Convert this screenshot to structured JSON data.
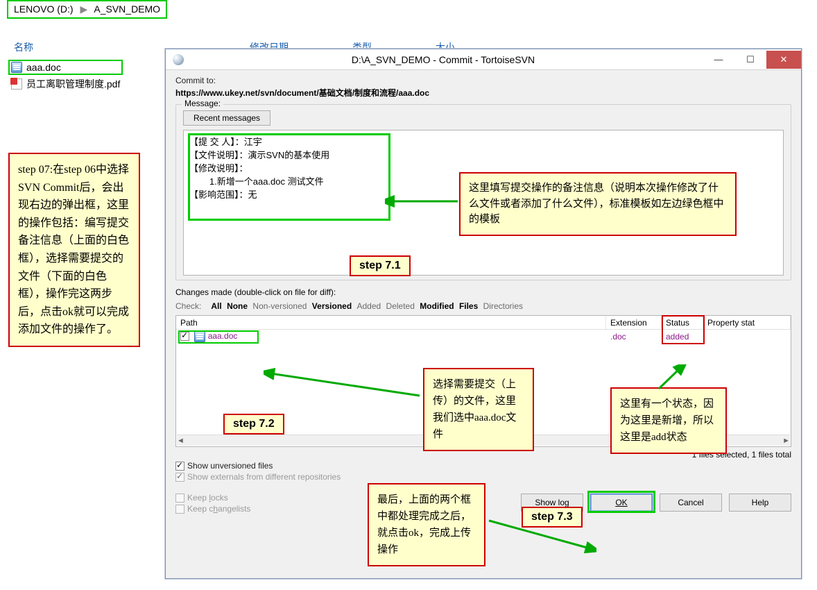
{
  "breadcrumb": {
    "drive": "LENOVO (D:)",
    "folder": "A_SVN_DEMO"
  },
  "columns": {
    "name": "名称",
    "date": "修改日期",
    "type": "类型",
    "size": "大小"
  },
  "files": {
    "f1": "aaa.doc",
    "f2": "员工离职管理制度.pdf"
  },
  "note_left": "step 07:在step 06中选择SVN Commit后，会出现右边的弹出框，这里的操作包括：编写提交备注信息（上面的白色框），选择需要提交的文件（下面的白色框），操作完这两步后，点击ok就可以完成添加文件的操作了。",
  "dialog": {
    "title": "D:\\A_SVN_DEMO - Commit - TortoiseSVN",
    "commit_to_lbl": "Commit to:",
    "commit_url": "https://www.ukey.net/svn/document/基础文档/制度和流程/aaa.doc",
    "message_lbl": "Message:",
    "recent_btn": "Recent messages",
    "msg_l1": "【提 交 人】：江宇",
    "msg_l2": "【文件说明】：演示SVN的基本使用",
    "msg_l3": "【修改说明】：",
    "msg_l4": "        1.新增一个aaa.doc 测试文件",
    "msg_l5": "【影响范围】：无",
    "changes_lbl": "Changes made (double-click on file for diff):",
    "check_lbl": "Check:",
    "chk_all": "All",
    "chk_none": "None",
    "chk_nonver": "Non-versioned",
    "chk_ver": "Versioned",
    "chk_added": "Added",
    "chk_deleted": "Deleted",
    "chk_mod": "Modified",
    "chk_files": "Files",
    "chk_dirs": "Directories",
    "hdr_path": "Path",
    "hdr_ext": "Extension",
    "hdr_stat": "Status",
    "hdr_prop": "Property stat",
    "row_file": "aaa.doc",
    "row_ext": ".doc",
    "row_stat": "added",
    "selinfo": "1 files selected, 1 files total",
    "show_unver": "Show unversioned files",
    "show_ext": "Show externals from different repositories",
    "keep_locks": "Keep locks",
    "keep_cl": "Keep changelists",
    "btn_showlog": "Show log",
    "btn_ok": "OK",
    "btn_cancel": "Cancel",
    "btn_help": "Help"
  },
  "notes": {
    "msg": "这里填写提交操作的备注信息（说明本次操作修改了什么文件或者添加了什么文件），标准模板如左边绿色框中的模板",
    "sel": "选择需要提交（上传）的文件，这里我们选中aaa.doc文件",
    "stat": "这里有一个状态，因为这里是新增，所以这里是add状态",
    "final": "最后，上面的两个框中都处理完成之后，就点击ok，完成上传操作"
  },
  "tags": {
    "t71": "step 7.1",
    "t72": "step 7.2",
    "t73": "step 7.3"
  }
}
